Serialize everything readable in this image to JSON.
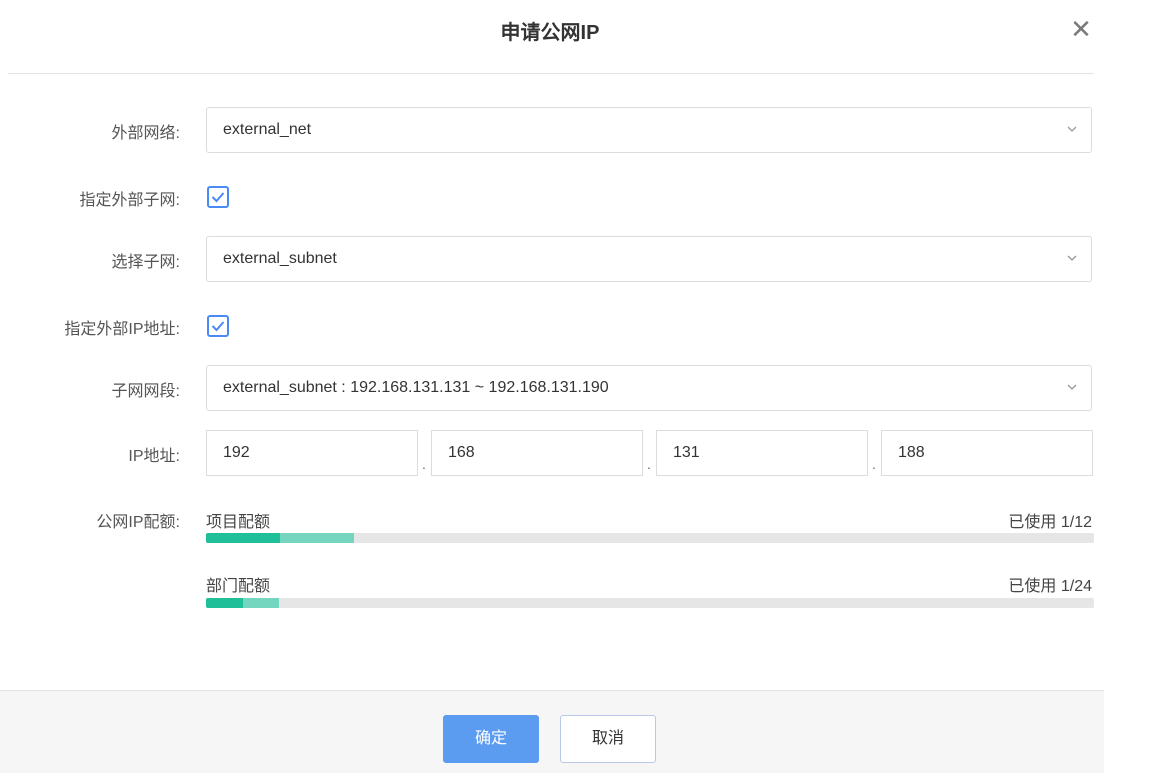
{
  "dialog": {
    "title": "申请公网IP",
    "close_icon": "close-icon"
  },
  "form": {
    "external_network": {
      "label": "外部网络:",
      "value": "external_net"
    },
    "specify_subnet": {
      "label": "指定外部子网:",
      "checked": true
    },
    "subnet": {
      "label": "选择子网:",
      "value": "external_subnet"
    },
    "specify_ip": {
      "label": "指定外部IP地址:",
      "checked": true
    },
    "subnet_range": {
      "label": "子网网段:",
      "value": "external_subnet : 192.168.131.131 ~ 192.168.131.190"
    },
    "ip_address": {
      "label": "IP地址:",
      "octets": [
        "192",
        "168",
        "131",
        "188"
      ],
      "separator": "."
    },
    "quota": {
      "label": "公网IP配额:",
      "items": [
        {
          "name": "项目配额",
          "used_text": "已使用 1/12",
          "used": 1,
          "total": 12,
          "reserved_fraction": 0.083
        },
        {
          "name": "部门配额",
          "used_text": "已使用 1/24",
          "used": 1,
          "total": 24,
          "reserved_fraction": 0.041
        }
      ]
    }
  },
  "footer": {
    "ok_label": "确定",
    "cancel_label": "取消"
  },
  "colors": {
    "accent": "#5b9bf0",
    "checkbox": "#4a8af4",
    "quota_used": "#1fbf9a",
    "quota_pending": "#74d6bf"
  }
}
